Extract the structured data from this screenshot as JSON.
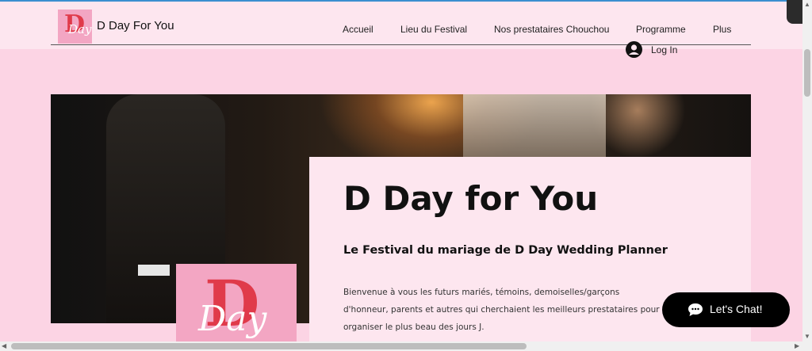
{
  "brand": {
    "name": "D Day For You",
    "logo_letter": "D",
    "logo_script": "Day"
  },
  "nav": {
    "items": [
      {
        "label": "Accueil"
      },
      {
        "label": "Lieu du Festival"
      },
      {
        "label": "Nos prestataires Chouchou"
      },
      {
        "label": "Programme"
      },
      {
        "label": "Plus"
      }
    ]
  },
  "login": {
    "label": "Log In"
  },
  "hero": {
    "title": "D Day for You",
    "subtitle": "Le Festival du mariage de D Day Wedding Planner",
    "paragraph": "Bienvenue à vous les futurs mariés, témoins, demoiselles/garçons d'honneur, parents et autres qui cherchaient les meilleurs prestataires pour organiser le plus beau des jours J."
  },
  "chat": {
    "label": "Let's Chat!",
    "icon": "chat-bubble-icon"
  },
  "colors": {
    "page_bg": "#fcd4e4",
    "header_bg": "#fde6ef",
    "logo_pink": "#f3a6c3",
    "logo_red": "#e03a4a",
    "chat_bg": "#000000"
  }
}
